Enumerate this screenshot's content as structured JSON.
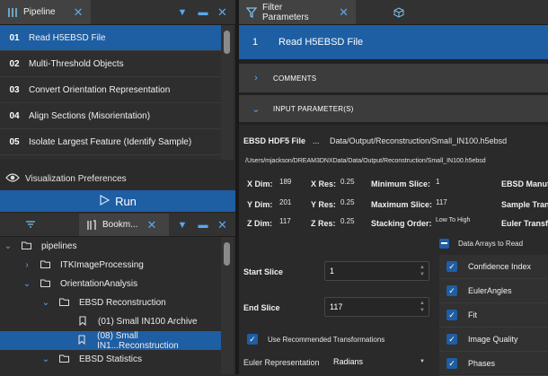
{
  "pipeline_pane": {
    "tab_label": "Pipeline",
    "items": [
      {
        "num": "01",
        "label": "Read H5EBSD File",
        "selected": true
      },
      {
        "num": "02",
        "label": "Multi-Threshold Objects",
        "selected": false
      },
      {
        "num": "03",
        "label": "Convert Orientation Representation",
        "selected": false
      },
      {
        "num": "04",
        "label": "Align Sections (Misorientation)",
        "selected": false
      },
      {
        "num": "05",
        "label": "Isolate Largest Feature (Identify Sample)",
        "selected": false
      }
    ],
    "viz_label": "Visualization Preferences",
    "run_label": "Run"
  },
  "bookmarks_pane": {
    "tab_label": "Bookm...",
    "tree": [
      {
        "level": 0,
        "type": "folder",
        "label": "pipelines",
        "expanded": true
      },
      {
        "level": 1,
        "type": "folder",
        "label": "ITKImageProcessing",
        "expanded": false
      },
      {
        "level": 1,
        "type": "folder",
        "label": "OrientationAnalysis",
        "expanded": true
      },
      {
        "level": 2,
        "type": "folder",
        "label": "EBSD Reconstruction",
        "expanded": true
      },
      {
        "level": 3,
        "type": "bookmark",
        "label": "(01) Small IN100 Archive"
      },
      {
        "level": 3,
        "type": "bookmark",
        "label": "(08) Small IN1...Reconstruction",
        "selected": true
      },
      {
        "level": 2,
        "type": "folder",
        "label": "EBSD Statistics",
        "expanded": true
      }
    ]
  },
  "filter_pane": {
    "tab_label": "Filter Parameters",
    "filter_index": "1",
    "filter_name": "Read H5EBSD File",
    "sections": {
      "comments": "COMMENTS",
      "input_params": "INPUT PARAMETER(S)"
    },
    "file_label": "EBSD HDF5 File",
    "file_button": "...",
    "file_value": "Data/Output/Reconstruction/Small_IN100.h5ebsd",
    "full_path": "/Users/mjackson/DREAM3DNXData/Data/Output/Reconstruction/Small_IN100.h5ebsd",
    "info": {
      "xdim_label": "X Dim:",
      "xdim": "189",
      "ydim_label": "Y Dim:",
      "ydim": "201",
      "zdim_label": "Z Dim:",
      "zdim": "117",
      "xres_label": "X Res:",
      "xres": "0.25",
      "yres_label": "Y Res:",
      "yres": "0.25",
      "zres_label": "Z Res:",
      "zres": "0.25",
      "minslice_label": "Minimum Slice:",
      "minslice": "1",
      "maxslice_label": "Maximum Slice:",
      "maxslice": "117",
      "stack_label": "Stacking Order:",
      "stack": "Low To High",
      "manuf_label": "EBSD Manufa",
      "transf_label": "Sample Transf",
      "euler_transf_label": "Euler Transfo"
    },
    "data_arrays_label": "Data Arrays to Read",
    "start_slice_label": "Start Slice",
    "start_slice_value": "1",
    "end_slice_label": "End Slice",
    "end_slice_value": "117",
    "use_transforms_label": "Use Recommended Transformations",
    "euler_rep_label": "Euler Representation",
    "euler_rep_value": "Radians",
    "arrays": [
      "Confidence Index",
      "EulerAngles",
      "Fit",
      "Image Quality",
      "Phases"
    ]
  },
  "colors": {
    "accent": "#1e5ea3",
    "icon": "#5aa8ec"
  }
}
